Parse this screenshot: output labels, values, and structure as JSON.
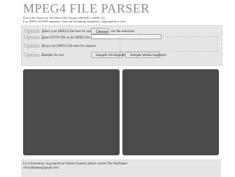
{
  "header": {
    "title": "MPEG4 FILE PARSER",
    "desc_line1": "Parse files based on ISO Base File Format (ISO/IEC 14496-12)",
    "desc_line2": "E.g. MPEG-DASH segments, Smooth Streaming fragments, 3gp/mp4/mov files"
  },
  "options": [
    {
      "label": "Option 1",
      "text": "Select your MPEG4 file here for analysis"
    },
    {
      "label": "Option 2",
      "text": "Insert HTTP URL to the MPEG file here"
    },
    {
      "label": "Option 3",
      "text": "Drop your MPEG4 file here for analysis"
    },
    {
      "label": "Option 4",
      "text": "Samples for test"
    }
  ],
  "file_input": {
    "button_label": "Choose File",
    "status": "No file selected"
  },
  "url_input": {
    "value": "",
    "placeholder": ""
  },
  "samples": {
    "init_label": "Sample Init Segment",
    "media_label": "Sample Media Segment"
  },
  "footer": {
    "line1": "For information, bug reports or feature requests please contact Ole Hallmaker",
    "line2": "ole.hallmaker@gmail.com"
  },
  "colors": {
    "panel_bg": "#e6e6e6",
    "output_box": "#4a4a4a",
    "title": "#8a8a8a"
  }
}
